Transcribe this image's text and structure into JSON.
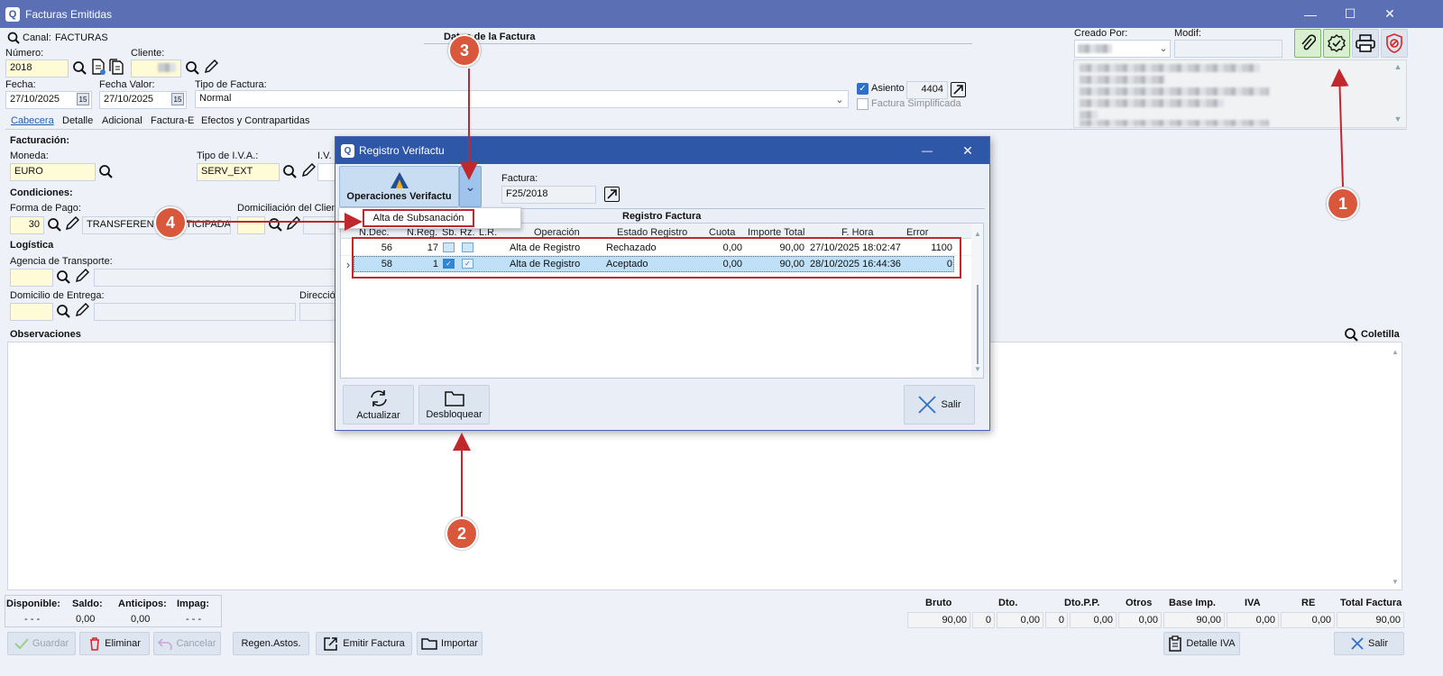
{
  "window": {
    "title": "Facturas Emitidas"
  },
  "header": {
    "canal_label": "Canal:",
    "canal_value": "FACTURAS",
    "section_title": "Datos de la Factura",
    "numero_label": "Número:",
    "numero_value": "2018",
    "cliente_label": "Cliente:",
    "fecha_label": "Fecha:",
    "fecha_value": "27/10/2025",
    "fecha_valor_label": "Fecha Valor:",
    "fecha_valor_value": "27/10/2025",
    "tipo_factura_label": "Tipo de Factura:",
    "tipo_factura_value": "Normal",
    "asiento_label": "Asiento",
    "asiento_value": "4404",
    "simplificada_label": "Factura Simplificada",
    "creado_por_label": "Creado Por:",
    "modif_label": "Modif:"
  },
  "tabs": [
    "Cabecera",
    "Detalle",
    "Adicional",
    "Factura-E",
    "Efectos y Contrapartidas"
  ],
  "form": {
    "facturacion": "Facturación:",
    "moneda_label": "Moneda:",
    "moneda_value": "EURO",
    "tipo_iva_label": "Tipo de I.V.A.:",
    "tipo_iva_value": "SERV_EXT",
    "iva_label": "I.V.",
    "condiciones": "Condiciones:",
    "forma_pago_label": "Forma de Pago:",
    "forma_pago_code": "30",
    "forma_pago_value": "TRANSFERENCIA ANTICIPADA",
    "domiciliacion_label": "Domiciliación del Cliente",
    "logistica": "Logística",
    "agencia_label": "Agencia de Transporte:",
    "domicilio_label": "Domicilio de Entrega:",
    "direccion_label": "Dirección",
    "observaciones": "Observaciones",
    "coletilla": "Coletilla"
  },
  "balance": {
    "disponible_label": "Disponible:",
    "saldo_label": "Saldo:",
    "anticipos_label": "Anticipos:",
    "impag_label": "Impag:",
    "disponible": "- - -",
    "saldo": "0,00",
    "anticipos": "0,00",
    "impag": "- - -"
  },
  "totals": {
    "bruto_label": "Bruto",
    "dto_label": "Dto.",
    "dtopp_label": "Dto.P.P.",
    "otros_label": "Otros",
    "base_label": "Base Imp.",
    "iva_label": "IVA",
    "re_label": "RE",
    "total_label": "Total Factura",
    "bruto": "90,00",
    "dto_pct": "0",
    "dto": "0,00",
    "dtopp_pct": "0",
    "dtopp": "0,00",
    "otros": "0,00",
    "base": "90,00",
    "iva": "0,00",
    "re": "0,00",
    "total": "90,00"
  },
  "footer": {
    "guardar": "Guardar",
    "eliminar": "Eliminar",
    "cancelar": "Cancelar",
    "regen": "Regen.Astos.",
    "emitir": "Emitir Factura",
    "importar": "Importar",
    "detalle_iva": "Detalle IVA",
    "salir": "Salir"
  },
  "dialog": {
    "title": "Registro Verifactu",
    "op_button": "Operaciones Verifactu",
    "factura_label": "Factura:",
    "factura_value": "F25/2018",
    "grid_title": "Registro Factura",
    "menu_item": "Alta de Subsanación",
    "columns": [
      "N.Dec.",
      "N.Reg.",
      "Sb.",
      "Rz.",
      "L.R.",
      "Operación",
      "Estado Registro",
      "Cuota",
      "Importe Total",
      "F. Hora",
      "Error"
    ],
    "rows": [
      {
        "ndec": "56",
        "nreg": "17",
        "op": "Alta de Registro",
        "estado": "Rechazado",
        "cuota": "0,00",
        "importe": "90,00",
        "fhora": "27/10/2025 18:02:47",
        "error": "1100"
      },
      {
        "ndec": "58",
        "nreg": "1",
        "op": "Alta de Registro",
        "estado": "Aceptado",
        "cuota": "0,00",
        "importe": "90,00",
        "fhora": "28/10/2025 16:44:36",
        "error": "0"
      }
    ],
    "actualizar": "Actualizar",
    "desbloquear": "Desbloquear",
    "salir": "Salir"
  },
  "markers": [
    "1",
    "2",
    "3",
    "4"
  ],
  "colors": {
    "titlebar": "#5a6fb4",
    "dialog_title": "#2f57a8",
    "annotation": "#c0282d",
    "marker": "#d9573b",
    "selected_row": "#bfe0f7"
  }
}
